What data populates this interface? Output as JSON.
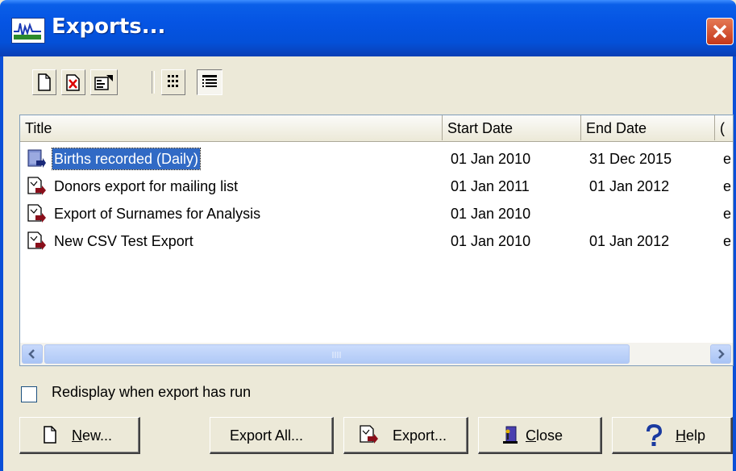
{
  "window": {
    "title": "Exports..."
  },
  "toolbar": {
    "buttons": [
      {
        "icon": "new-document-icon"
      },
      {
        "icon": "delete-icon"
      },
      {
        "icon": "properties-icon"
      },
      {
        "icon": "large-icons-view-icon"
      },
      {
        "icon": "details-view-icon",
        "pressed": true
      }
    ]
  },
  "list": {
    "columns": [
      "Title",
      "Start Date",
      "End Date",
      "("
    ],
    "rows": [
      {
        "title": "Births recorded (Daily)",
        "start": "01 Jan 2010",
        "end": "31 Dec 2015",
        "extra": "e",
        "selected": true
      },
      {
        "title": "Donors export for mailing list",
        "start": "01 Jan 2011",
        "end": "01 Jan 2012",
        "extra": "e"
      },
      {
        "title": "Export of Surnames for Analysis",
        "start": "01 Jan 2010",
        "end": "",
        "extra": "e"
      },
      {
        "title": "New CSV Test Export",
        "start": "01 Jan 2010",
        "end": "01 Jan 2012",
        "extra": "e"
      }
    ]
  },
  "options": {
    "redisplay_label": "Redisplay when export has run",
    "redisplay_checked": false
  },
  "buttons": {
    "new": "New...",
    "export_all": "Export All...",
    "export": "Export...",
    "close": "Close",
    "help": "Help"
  },
  "colors": {
    "selection": "#316ac5",
    "titlebar": "#0554e3",
    "face": "#ece9d8"
  }
}
